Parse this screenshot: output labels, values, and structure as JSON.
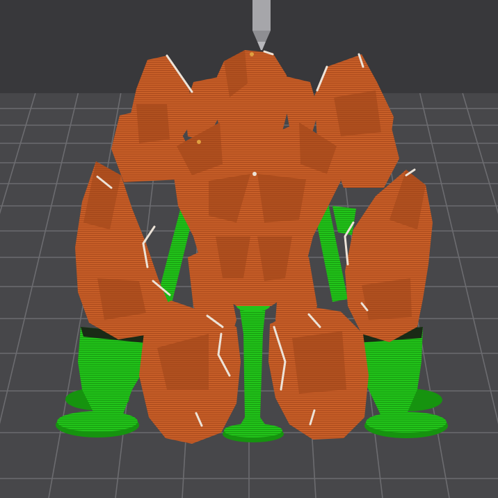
{
  "viewport": {
    "background_color": "#38383b",
    "bed_color": "#4a4a4d",
    "grid_color": "#6c6c70",
    "nozzle_color": "#a9a9ad"
  },
  "model": {
    "part_color": "#c85f28",
    "part_shadow_color": "#9e4519",
    "support_color": "#22c41a",
    "support_dark_color": "#16930f",
    "highlight_color": "#e9e0d6"
  }
}
